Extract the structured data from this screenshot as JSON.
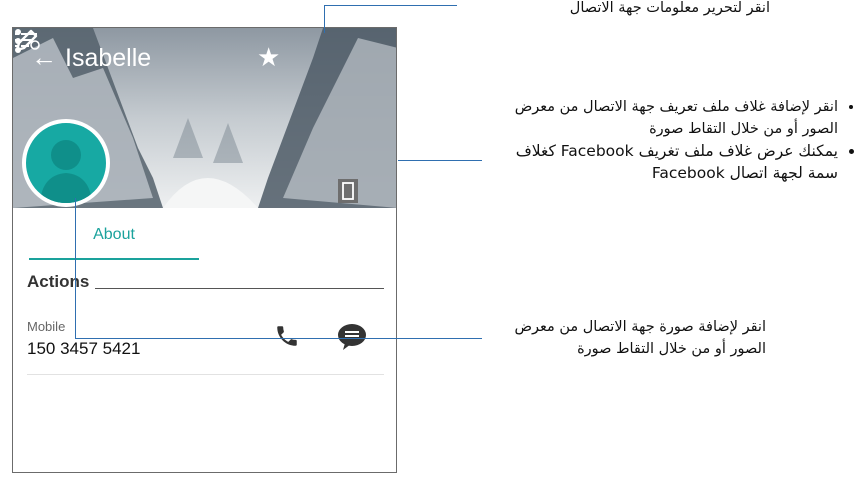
{
  "header": {
    "contact_name": "Isabelle",
    "back_glyph": "←",
    "star_glyph": "★"
  },
  "tabs": [
    {
      "label": "About",
      "active": true
    }
  ],
  "actions": {
    "title": "Actions",
    "mobile_label": "Mobile",
    "mobile_number": "150 3457 5421"
  },
  "icons": {
    "back": "back-arrow-icon",
    "star": "star-icon",
    "edit": "pencil-icon",
    "more": "more-vert-icon",
    "avatar": "person-icon",
    "call": "phone-icon",
    "message": "chat-icon"
  },
  "annotations": {
    "edit_note": "انقر لتحرير معلومات جهة الاتصال",
    "cover_bullet_1": "انقر لإضافة غلاف ملف تعريف جهة الاتصال من معرض الصور أو من خلال التقاط صورة",
    "cover_bullet_2": "يمكنك عرض غلاف ملف تغريف Facebook كغلاف سمة لجهة اتصال Facebook",
    "photo_note": "انقر لإضافة صورة جهة الاتصال من معرض الصور أو من خلال التقاط صورة"
  },
  "colors": {
    "accent": "#1aa29c",
    "callout_line": "#2f6fb0",
    "avatar_bg": "#17a9a3"
  }
}
